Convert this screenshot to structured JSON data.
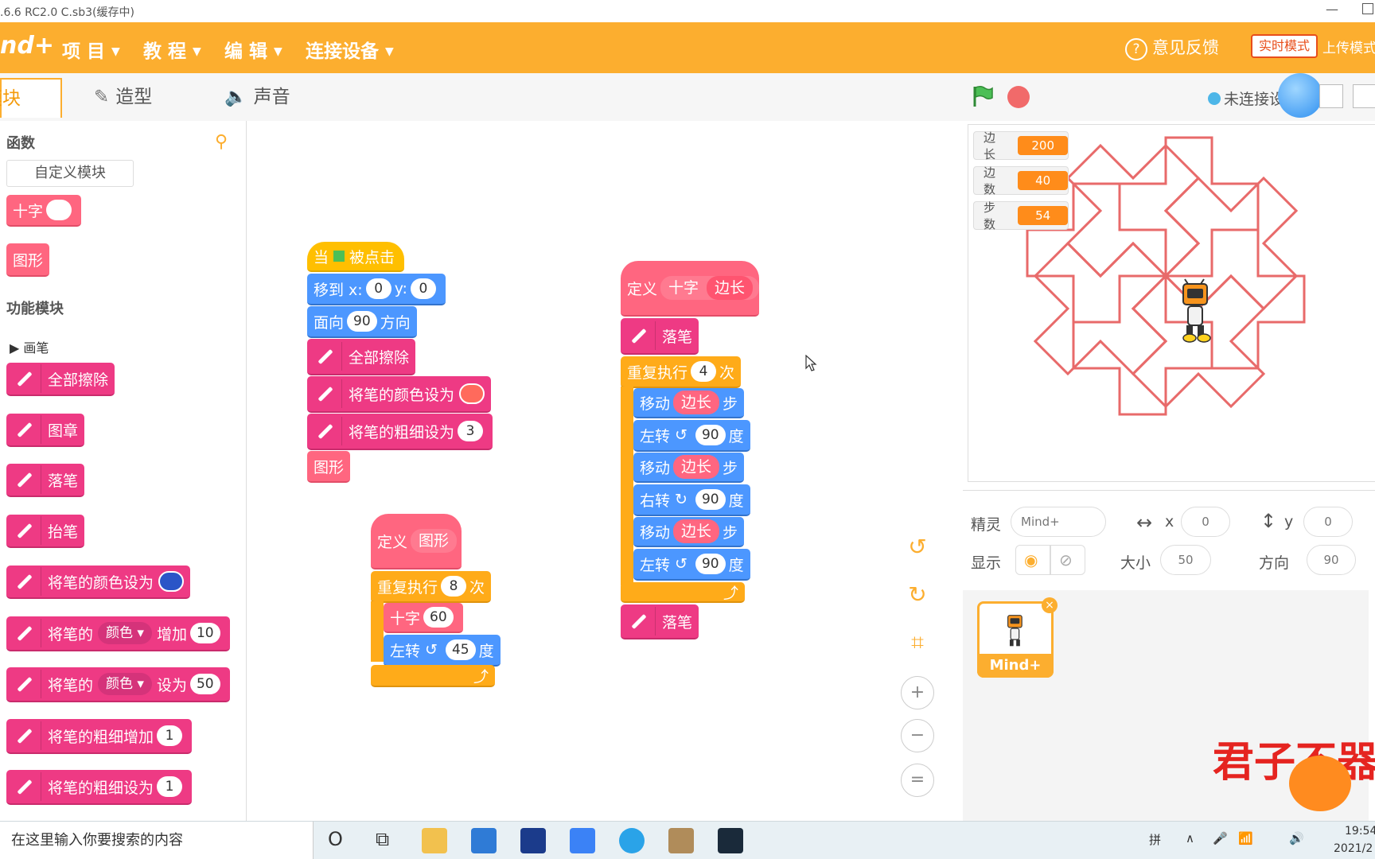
{
  "window": {
    "title": ".6.6 RC2.0   C.sb3(缓存中)",
    "minimize": "—"
  },
  "menubar": {
    "logo": "nd+",
    "menus": [
      "项 目",
      "教 程",
      "编 辑",
      "连接设备"
    ],
    "caret": "▼",
    "feedback": "意见反馈",
    "feedback_icon": "?",
    "mode_realtime": "实时模式",
    "mode_upload": "上传模式"
  },
  "tabs": {
    "blocks": "模块",
    "costumes": "造型",
    "sounds": "声音"
  },
  "palette": {
    "section_functions": "函数",
    "custom_block_button": "自定义模块",
    "cross_block": "十字",
    "shape_block": "图形",
    "section_function_modules": "功能模块",
    "pen_category": "画笔",
    "pen_blocks": {
      "erase_all": "全部擦除",
      "stamp": "图章",
      "pen_down": "落笔",
      "pen_up": "抬笔",
      "set_color": "将笔的颜色设为",
      "change_prefix": "将笔的",
      "param_color": "颜色",
      "change_by": "增加",
      "change_value": "10",
      "set_to": "设为",
      "set_value": "50",
      "change_size": "将笔的粗细增加",
      "change_size_value": "1",
      "set_size": "将笔的粗细设为",
      "set_size_value": "1"
    },
    "pin_icon": "⚲"
  },
  "script_main": {
    "hat": "当",
    "hat_suffix": "被点击",
    "goto_label": "移到 x:",
    "goto_x": "0",
    "goto_y_label": "y:",
    "goto_y": "0",
    "point_label": "面向",
    "point_value": "90",
    "point_suffix": "方向",
    "erase": "全部擦除",
    "set_color": "将笔的颜色设为",
    "set_size": "将笔的粗细设为",
    "set_size_value": "3",
    "call_shape": "图形"
  },
  "script_shape": {
    "define": "定义",
    "name": "图形",
    "repeat": "重复执行",
    "repeat_count": "8",
    "times": "次",
    "cross": "十字",
    "cross_value": "60",
    "turn_left": "左转",
    "turn_value": "45",
    "degrees": "度",
    "loop_arrow": "⤴"
  },
  "script_cross": {
    "define": "定义",
    "name": "十字",
    "param": "边长",
    "pen_down": "落笔",
    "repeat": "重复执行",
    "repeat_count": "4",
    "times": "次",
    "move": "移动",
    "steps": "步",
    "turn_left": "左转",
    "turn_right": "右转",
    "turn_value": "90",
    "degrees": "度",
    "ccw": "↺",
    "cw": "↻",
    "pen_down2": "落笔",
    "loop_arrow": "⤴"
  },
  "zoom_controls": {
    "undo": "↺",
    "redo": "↻",
    "crop": "⌗",
    "zoom_in": "+",
    "zoom_out": "−",
    "reset": "="
  },
  "stage_header": {
    "status": "未连接设备"
  },
  "monitors": [
    {
      "label": "边长",
      "value": "200"
    },
    {
      "label": "边数",
      "value": "40"
    },
    {
      "label": "步数",
      "value": "54"
    }
  ],
  "sprite_info": {
    "sprite_label": "精灵",
    "sprite_name": "Mind+",
    "x_icon": "↔",
    "x_label": "x",
    "x_value": "0",
    "y_icon": "↕",
    "y_label": "y",
    "y_value": "0",
    "show_label": "显示",
    "show_icon": "◉",
    "hide_icon": "⊘",
    "size_label": "大小",
    "size_value": "50",
    "direction_label": "方向",
    "direction_value": "90"
  },
  "sprite_list": {
    "name": "Mind+",
    "delete": "×"
  },
  "overlay_text": "君子不器",
  "taskbar": {
    "search_placeholder": "在这里输入你要搜索的内容",
    "cortana_icon": "O",
    "taskview_icon": "⧉",
    "ime": "拼",
    "tray_caret": "∧",
    "time": "19:54",
    "date": "2021/2"
  },
  "colors": {
    "accent": "#fcae2f",
    "pen_block": "#ee3a84",
    "custom_block": "#ff6680",
    "control_block": "#ffab19",
    "motion_block": "#4c97ff",
    "event_block": "#ffbf00",
    "stage_pattern": "#e86a6a"
  }
}
